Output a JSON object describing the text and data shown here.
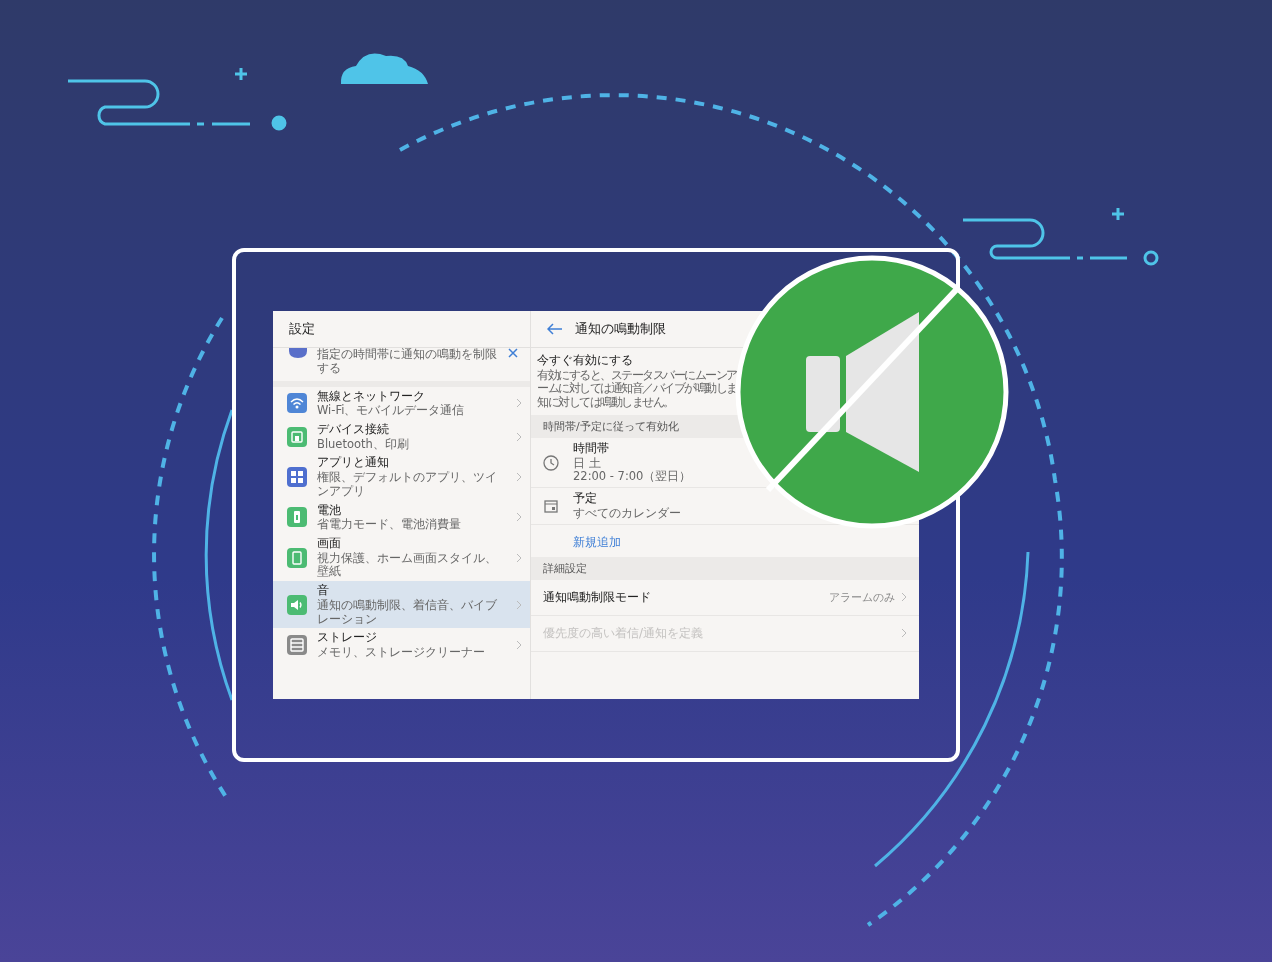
{
  "settings": {
    "title": "設定",
    "banner_subtitle": "指定の時間帯に通知の鳴動を制限する",
    "items": [
      {
        "kind": "wifi",
        "title": "無線とネットワーク",
        "subtitle": "Wi-Fi、モバイルデータ通信",
        "color": "#4f86d6",
        "selected": false
      },
      {
        "kind": "device",
        "title": "デバイス接続",
        "subtitle": "Bluetooth、印刷",
        "color": "#4cbb73",
        "selected": false
      },
      {
        "kind": "apps",
        "title": "アプリと通知",
        "subtitle": "権限、デフォルトのアプリ、ツインアプリ",
        "color": "#4f6fcf",
        "selected": false
      },
      {
        "kind": "battery",
        "title": "電池",
        "subtitle": "省電力モード、電池消費量",
        "color": "#4cbb73",
        "selected": false
      },
      {
        "kind": "display",
        "title": "画面",
        "subtitle": "視力保護、ホーム画面スタイル、壁紙",
        "color": "#4cbb73",
        "selected": false
      },
      {
        "kind": "sound",
        "title": "音",
        "subtitle": "通知の鳴動制限、着信音、バイブレーション",
        "color": "#4cbb73",
        "selected": true
      },
      {
        "kind": "storage",
        "title": "ストレージ",
        "subtitle": "メモリ、ストレージクリーナー",
        "color": "#8a8a8a",
        "selected": false
      }
    ]
  },
  "detail": {
    "title": "通知の鳴動制限",
    "now": {
      "title": "今すぐ有効にする",
      "lines": [
        "有効にすると、ステータスバーにムーンア",
        "ームに対しては通知音／バイブが鳴動しま",
        "知に対しては鳴動しません。"
      ]
    },
    "section_1": "時間帯/予定に従って有効化",
    "schedules": [
      {
        "kind": "clock",
        "title": "時間帯",
        "lines": [
          "日 土",
          "22:00 - 7:00（翌日）"
        ]
      },
      {
        "kind": "calendar",
        "title": "予定",
        "lines": [
          "すべてのカレンダー"
        ]
      }
    ],
    "add": "新規追加",
    "section_2": "詳細設定",
    "rows": [
      {
        "title": "通知鳴動制限モード",
        "value": "アラームのみ",
        "disabled": false
      },
      {
        "title": "優先度の高い着信/通知を定義",
        "disabled": true
      }
    ]
  }
}
